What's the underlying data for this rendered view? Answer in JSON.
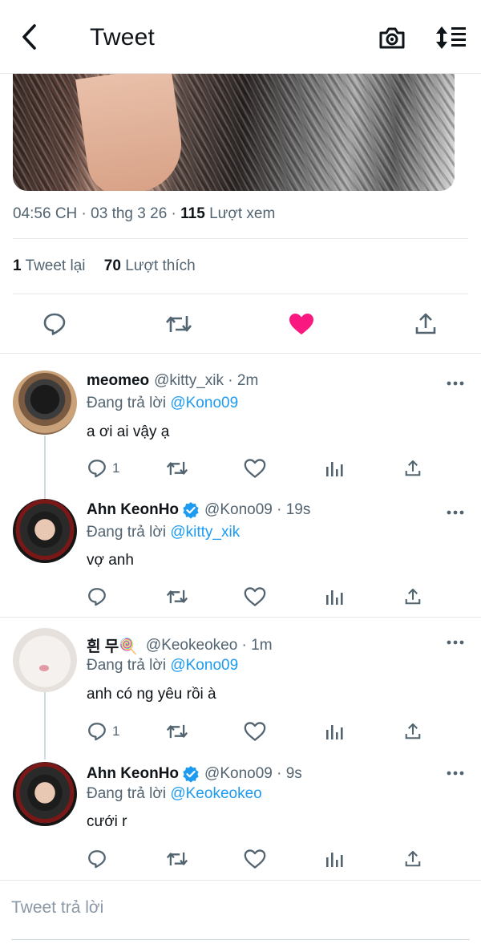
{
  "header": {
    "title": "Tweet"
  },
  "tweet": {
    "time": "04:56 CH",
    "date": "03 thg 3 26",
    "views_count": "115",
    "views_label": "Lượt xem",
    "retweets_count": "1",
    "retweets_label": "Tweet lại",
    "likes_count": "70",
    "likes_label": "Lượt thích"
  },
  "replies": [
    {
      "name": "meomeo",
      "handle": "@kitty_xik",
      "time": "2m",
      "replying_prefix": "Đang trả lời",
      "replying_to": "@Kono09",
      "text": "a ơi ai vậy ạ",
      "reply_count": "1"
    },
    {
      "name": "Ahn KeonHo",
      "handle": "@Kono09",
      "time": "19s",
      "replying_prefix": "Đang trả lời",
      "replying_to": "@kitty_xik",
      "text": "vợ anh",
      "reply_count": ""
    },
    {
      "name": "흰 무🍭",
      "handle": "@Keokeokeo",
      "time": "1m",
      "replying_prefix": "Đang trả lời",
      "replying_to": "@Kono09",
      "text": "anh có ng yêu rồi à",
      "reply_count": "1"
    },
    {
      "name": "Ahn KeonHo",
      "handle": "@Kono09",
      "time": "9s",
      "replying_prefix": "Đang trả lời",
      "replying_to": "@Keokeokeo",
      "text": "cưới r",
      "reply_count": ""
    }
  ],
  "composer": {
    "placeholder": "Tweet trả lời"
  },
  "colors": {
    "accent": "#1d9bf0",
    "like": "#f91880",
    "muted": "#536471"
  }
}
